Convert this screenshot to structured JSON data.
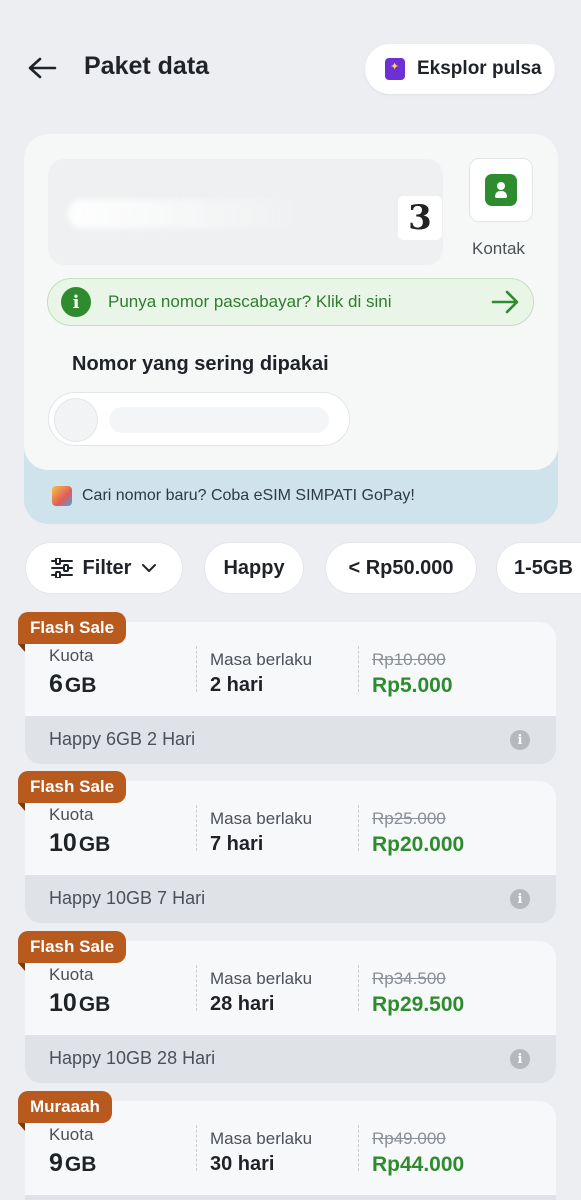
{
  "header": {
    "title": "Paket data",
    "explore_label": "Eksplor pulsa"
  },
  "number_section": {
    "operator_logo": "3",
    "contact_label": "Kontak",
    "postpaid_text": "Punya nomor pascabayar? Klik di sini",
    "frequent_label": "Nomor yang sering dipakai",
    "esim_text": "Cari nomor baru? Coba eSIM SIMPATI GoPay!"
  },
  "filters": {
    "filter_label": "Filter",
    "chips": [
      "Happy",
      "< Rp50.000",
      "1-5GB"
    ]
  },
  "packages": [
    {
      "badge": "Flash Sale",
      "quota_label": "Kuota",
      "quota_value": "6",
      "quota_unit": "GB",
      "validity_label": "Masa berlaku",
      "validity_value": "2 hari",
      "old_price": "Rp10.000",
      "new_price": "Rp5.000",
      "name": "Happy 6GB 2 Hari"
    },
    {
      "badge": "Flash Sale",
      "quota_label": "Kuota",
      "quota_value": "10",
      "quota_unit": "GB",
      "validity_label": "Masa berlaku",
      "validity_value": "7 hari",
      "old_price": "Rp25.000",
      "new_price": "Rp20.000",
      "name": "Happy 10GB 7 Hari"
    },
    {
      "badge": "Flash Sale",
      "quota_label": "Kuota",
      "quota_value": "10",
      "quota_unit": "GB",
      "validity_label": "Masa berlaku",
      "validity_value": "28 hari",
      "old_price": "Rp34.500",
      "new_price": "Rp29.500",
      "name": "Happy 10GB 28 Hari"
    },
    {
      "badge": "Muraaah",
      "quota_label": "Kuota",
      "quota_value": "9",
      "quota_unit": "GB",
      "validity_label": "Masa berlaku",
      "validity_value": "30 hari",
      "old_price": "Rp49.000",
      "new_price": "Rp44.000",
      "name": ""
    }
  ],
  "colors": {
    "accent_green": "#2e8b2e",
    "badge": "#b85a1e",
    "background": "#eceef2"
  }
}
